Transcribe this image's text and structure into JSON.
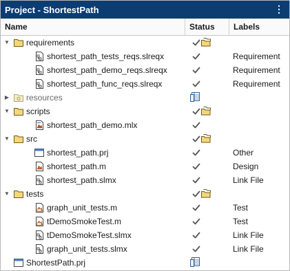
{
  "window": {
    "title": "Project - ShortestPath",
    "menu_icon": "vertical-dots-icon"
  },
  "columns": {
    "name": "Name",
    "status": "Status",
    "labels": "Labels"
  },
  "colors": {
    "titlebar": "#0b3d73",
    "folder": "#f5d77a",
    "check": "#555555"
  },
  "rows": [
    {
      "name": "requirements",
      "depth": 0,
      "kind": "folder",
      "expanded": true,
      "status": "check-folder",
      "label": ""
    },
    {
      "name": "shortest_path_tests_reqs.slreqx",
      "depth": 1,
      "kind": "req-file",
      "status": "check",
      "label": "Requirement"
    },
    {
      "name": "shortest_path_demo_reqs.slreqx",
      "depth": 1,
      "kind": "req-file",
      "status": "check",
      "label": "Requirement"
    },
    {
      "name": "shortest_path_func_reqs.slreqx",
      "depth": 1,
      "kind": "req-file",
      "status": "check",
      "label": "Requirement"
    },
    {
      "name": "resources",
      "depth": 0,
      "kind": "resource-folder",
      "expanded": false,
      "status": "project-table",
      "label": "",
      "muted": true
    },
    {
      "name": "scripts",
      "depth": 0,
      "kind": "folder",
      "expanded": true,
      "status": "check-folder",
      "label": ""
    },
    {
      "name": "shortest_path_demo.mlx",
      "depth": 1,
      "kind": "mlx-file",
      "status": "check",
      "label": ""
    },
    {
      "name": "src",
      "depth": 0,
      "kind": "folder",
      "expanded": true,
      "status": "check-folder",
      "label": ""
    },
    {
      "name": "shortest_path.prj",
      "depth": 1,
      "kind": "prj-file",
      "status": "check",
      "label": "Other"
    },
    {
      "name": "shortest_path.m",
      "depth": 1,
      "kind": "m-file",
      "status": "check",
      "label": "Design"
    },
    {
      "name": "shortest_path.slmx",
      "depth": 1,
      "kind": "slmx-file",
      "status": "check",
      "label": "Link File"
    },
    {
      "name": "tests",
      "depth": 0,
      "kind": "folder",
      "expanded": true,
      "status": "check-folder",
      "label": ""
    },
    {
      "name": "graph_unit_tests.m",
      "depth": 1,
      "kind": "test-file",
      "status": "check",
      "label": "Test"
    },
    {
      "name": "tDemoSmokeTest.m",
      "depth": 1,
      "kind": "test-file",
      "status": "check",
      "label": "Test"
    },
    {
      "name": "tDemoSmokeTest.slmx",
      "depth": 1,
      "kind": "slmx-file",
      "status": "check",
      "label": "Link File"
    },
    {
      "name": "graph_unit_tests.slmx",
      "depth": 1,
      "kind": "slmx-file",
      "status": "check",
      "label": "Link File"
    },
    {
      "name": "ShortestPath.prj",
      "depth": 0,
      "kind": "prj-file",
      "status": "project-table",
      "label": "",
      "noarrow": true
    }
  ]
}
